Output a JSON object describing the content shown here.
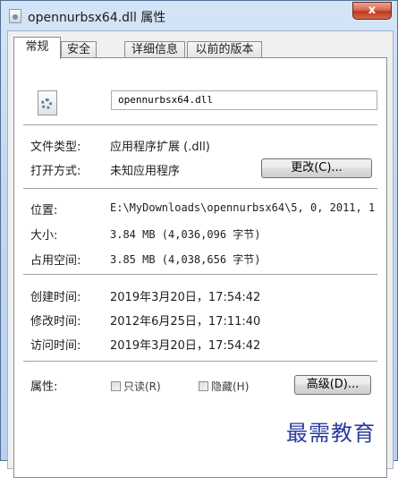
{
  "window": {
    "title": "opennurbsx64.dll 属性",
    "close_label": "x"
  },
  "tabs": [
    {
      "label": "常规"
    },
    {
      "label": "安全"
    },
    {
      "label": "详细信息"
    },
    {
      "label": "以前的版本"
    }
  ],
  "general": {
    "file_name": "opennurbsx64.dll",
    "file_type_label": "文件类型:",
    "file_type_value": "应用程序扩展 (.dll)",
    "opens_with_label": "打开方式:",
    "opens_with_value": "未知应用程序",
    "change_button": "更改(C)...",
    "location_label": "位置:",
    "location_value": "E:\\MyDownloads\\opennurbsx64\\5, 0, 2011, 1",
    "size_label": "大小:",
    "size_value": "3.84 MB (4,036,096 字节)",
    "size_on_disk_label": "占用空间:",
    "size_on_disk_value": "3.85 MB (4,038,656 字节)",
    "created_label": "创建时间:",
    "created_value": "2019年3月20日，17:54:42",
    "modified_label": "修改时间:",
    "modified_value": "2012年6月25日，17:11:40",
    "accessed_label": "访问时间:",
    "accessed_value": "2019年3月20日，17:54:42",
    "attributes_label": "属性:",
    "readonly_label": "只读(R)",
    "hidden_label": "隐藏(H)",
    "advanced_button": "高级(D)..."
  },
  "watermark": "最需教育"
}
